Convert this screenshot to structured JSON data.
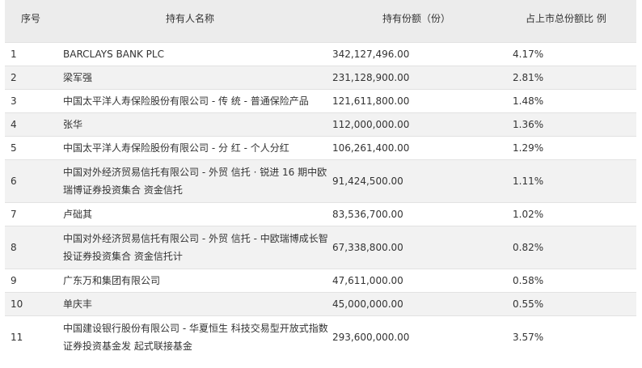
{
  "table": {
    "headers": {
      "index": "序号",
      "name": "持有人名称",
      "shares": "持有份额（份）",
      "percent": "占上市总份额比 例"
    },
    "rows": [
      {
        "index": "1",
        "name": "BARCLAYS BANK PLC",
        "shares": "342,127,496.00",
        "percent": "4.17%"
      },
      {
        "index": "2",
        "name": "梁军强",
        "shares": "231,128,900.00",
        "percent": "2.81%"
      },
      {
        "index": "3",
        "name": "中国太平洋人寿保险股份有限公司 - 传 统 - 普通保险产品",
        "shares": "121,611,800.00",
        "percent": "1.48%"
      },
      {
        "index": "4",
        "name": "张华",
        "shares": "112,000,000.00",
        "percent": "1.36%"
      },
      {
        "index": "5",
        "name": "中国太平洋人寿保险股份有限公司 - 分 红 - 个人分红",
        "shares": "106,261,400.00",
        "percent": "1.29%"
      },
      {
        "index": "6",
        "name": "中国对外经济贸易信托有限公司 - 外贸 信托 · 锐进 16 期中欧瑞博证券投资集合 资金信托",
        "shares": "91,424,500.00",
        "percent": "1.11%"
      },
      {
        "index": "7",
        "name": "卢础其",
        "shares": "83,536,700.00",
        "percent": "1.02%"
      },
      {
        "index": "8",
        "name": "中国对外经济贸易信托有限公司 - 外贸 信托 - 中欧瑞博成长智投证券投资集合 资金信托计",
        "shares": "67,338,800.00",
        "percent": "0.82%"
      },
      {
        "index": "9",
        "name": "广东万和集团有限公司",
        "shares": "47,611,000.00",
        "percent": "0.58%"
      },
      {
        "index": "10",
        "name": "单庆丰",
        "shares": "45,000,000.00",
        "percent": "0.55%"
      },
      {
        "index": "11",
        "name": "中国建设银行股份有限公司 - 华夏恒生 科技交易型开放式指数证券投资基金发 起式联接基金",
        "shares": "293,600,000.00",
        "percent": "3.57%"
      }
    ]
  }
}
